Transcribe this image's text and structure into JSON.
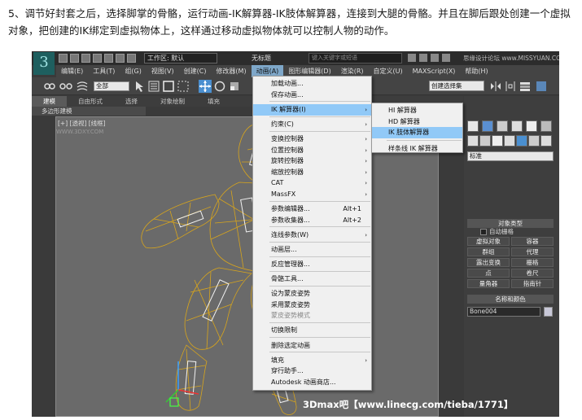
{
  "instruction": "5、调节好封套之后，选择脚掌的骨骼，运行动画-IK解算器-IK肢体解算器，连接到大腿的骨骼。并且在脚后跟处创建一个虚拟对象，把创建的IK绑定到虚拟物体上，这样通过移动虚拟物体就可以控制人物的动作。",
  "titlebar": {
    "workspace": "工作区: 默认",
    "title": "无标题",
    "search_placeholder": "键入关键字或短语",
    "watermark": "思缘设计论坛 www.MISSYUAN.COM"
  },
  "menubar": [
    "编辑(E)",
    "工具(T)",
    "组(G)",
    "视图(V)",
    "创建(C)",
    "修改器(M)",
    "动画(A)",
    "图形编辑器(D)",
    "渲染(R)",
    "自定义(U)",
    "MAXScript(X)",
    "帮助(H)"
  ],
  "toolbar": {
    "selection_filter": "全部",
    "named_selection": "创建选择集"
  },
  "ribbon": {
    "tabs": [
      "建模",
      "自由形式",
      "选择",
      "对象绘制",
      "填充"
    ],
    "sub": "多边形建模"
  },
  "viewport": {
    "label": "[+] [透视] [线框]",
    "watermark": "WWW.3DXY.COM",
    "bottom_watermark": "3Dmax吧【www.linecg.com/tieba/1771】"
  },
  "command_panel": {
    "category": "标准",
    "object_type_header": "对象类型",
    "autogrid": "自动栅格",
    "objects": [
      "虚拟对象",
      "容器",
      "群组",
      "代理",
      "露出变换",
      "栅格",
      "点",
      "卷尺",
      "量角器",
      "指南针"
    ],
    "name_color_header": "名称和颜色",
    "object_name": "Bone004"
  },
  "animation_menu": {
    "items": [
      {
        "label": "加载动画...",
        "sep_after": false
      },
      {
        "label": "保存动画...",
        "sep_after": true
      },
      {
        "label": "IK 解算器(I)",
        "arrow": true,
        "hover": true,
        "sep_after": true
      },
      {
        "label": "约束(C)",
        "arrow": true,
        "sep_after": true
      },
      {
        "label": "变换控制器",
        "arrow": true
      },
      {
        "label": "位置控制器",
        "arrow": true
      },
      {
        "label": "旋转控制器",
        "arrow": true
      },
      {
        "label": "缩放控制器",
        "arrow": true
      },
      {
        "label": "CAT",
        "arrow": true
      },
      {
        "label": "MassFX",
        "arrow": true,
        "sep_after": true
      },
      {
        "label": "参数编辑器...",
        "shortcut": "Alt+1"
      },
      {
        "label": "参数收集器...",
        "shortcut": "Alt+2",
        "sep_after": true
      },
      {
        "label": "连线参数(W)",
        "arrow": true,
        "sep_after": true
      },
      {
        "label": "动画层...",
        "sep_after": true
      },
      {
        "label": "反应管理器...",
        "sep_after": true
      },
      {
        "label": "骨骼工具...",
        "sep_after": true
      },
      {
        "label": "设为蒙皮姿势"
      },
      {
        "label": "采用蒙皮姿势"
      },
      {
        "label": "蒙皮姿势模式",
        "disabled": true,
        "sep_after": true
      },
      {
        "label": "切换限制",
        "sep_after": true
      },
      {
        "label": "删除选定动画",
        "sep_after": true
      },
      {
        "label": "填充",
        "arrow": true
      },
      {
        "label": "穿行助手..."
      },
      {
        "label": "Autodesk 动画商店..."
      }
    ]
  },
  "ik_submenu": {
    "items": [
      {
        "label": "HI 解算器"
      },
      {
        "label": "HD 解算器"
      },
      {
        "label": "IK 肢体解算器",
        "hover": true,
        "sep_after": true
      },
      {
        "label": "样条线 IK 解算器"
      }
    ]
  },
  "colors": {
    "wireframe": "#d8a51c",
    "menu_hover": "#91c9f7",
    "viewport_bg": "#6a6a6a"
  }
}
